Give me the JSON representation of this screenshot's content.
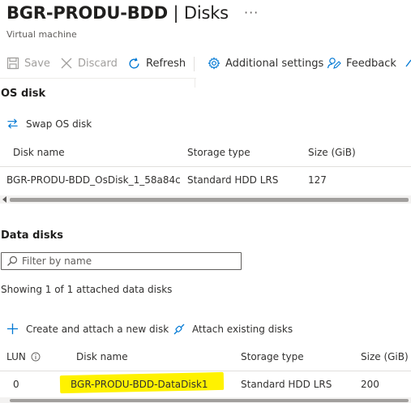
{
  "header": {
    "title_main": "BGR-PRODU-BDD",
    "title_sep": " | ",
    "title_page": "Disks",
    "more": "···",
    "subtitle": "Virtual machine"
  },
  "toolbar": {
    "save": "Save",
    "discard": "Discard",
    "refresh": "Refresh",
    "additional_settings": "Additional settings",
    "feedback": "Feedback"
  },
  "os_disk": {
    "heading": "OS disk",
    "swap": "Swap OS disk",
    "columns": [
      "Disk name",
      "Storage type",
      "Size (GiB)"
    ],
    "row": {
      "name": "BGR-PRODU-BDD_OsDisk_1_58a84c",
      "storage": "Standard HDD LRS",
      "size": "127"
    }
  },
  "data_disks": {
    "heading": "Data disks",
    "filter_placeholder": "Filter by name",
    "showing": "Showing 1 of 1 attached data disks",
    "create": "Create and attach a new disk",
    "attach": "Attach existing disks",
    "columns": [
      "LUN",
      "Disk name",
      "Storage type",
      "Size (GiB)"
    ],
    "row": {
      "lun": "0",
      "name": "BGR-PRODU-BDD-DataDisk1",
      "storage": "Standard HDD LRS",
      "size": "200"
    }
  },
  "colors": {
    "accent": "#0078d4",
    "highlight": "#fff200",
    "disabled": "#a19f9d"
  }
}
